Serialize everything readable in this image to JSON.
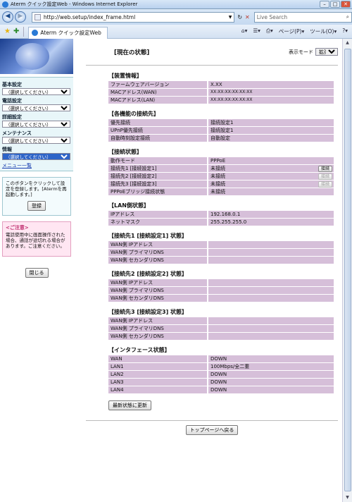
{
  "window": {
    "title": "Aterm クイック設定Web - Windows Internet Explorer",
    "url": "http://web.setup/index_frame.html",
    "search_placeholder": "Live Search",
    "tab_label": "Aterm クイック設定Web",
    "tools": {
      "page": "ページ(P)",
      "tool": "ツール(O)"
    }
  },
  "sidebar": {
    "sections": [
      {
        "label": "基本設定",
        "select": "（選択してください）"
      },
      {
        "label": "電話設定",
        "select": "（選択してください）"
      },
      {
        "label": "詳細設定",
        "select": "（選択してください）"
      },
      {
        "label": "メンテナンス",
        "select": "（選択してください）"
      },
      {
        "label": "情報",
        "select": "（選択してください）"
      }
    ],
    "menu_list": "メニュー一覧",
    "register_text": "このボタンをクリックして設定を登録します。[Atermを再起動します。]",
    "register_button": "登録",
    "caution_title": "<ご注意>",
    "caution_text": "電話使用中に画面操作された場合、通話が途切れる場合があります。ご注意ください。",
    "close_button": "閉じる"
  },
  "main": {
    "title": "[現在の状態]",
    "mode_label": "表示モード",
    "mode_value": "拡張",
    "refresh_button": "最新状態に更新",
    "top_button": "トップページへ戻る",
    "sections": [
      {
        "title": "【装置情報】",
        "rows": [
          {
            "k": "ファームウェアバージョン",
            "v": "X.XX"
          },
          {
            "k": "MACアドレス(WAN)",
            "v": "XX:XX:XX:XX:XX:XX",
            "small": true
          },
          {
            "k": "MACアドレス(LAN)",
            "v": "XX:XX:XX:XX:XX:XX",
            "small": true
          }
        ]
      },
      {
        "title": "【各機能の接続先】",
        "rows": [
          {
            "k": "優先接続",
            "v": "接続設定1"
          },
          {
            "k": "UPnP優先接続",
            "v": "接続設定1"
          },
          {
            "k": "自動時刻設定接続",
            "v": "自動設定"
          }
        ]
      },
      {
        "title": "【接続状態】",
        "rows": [
          {
            "k": "動作モード",
            "v": "PPPoE"
          },
          {
            "k": "接続先1 [接続設定1]",
            "v": "未接続",
            "btn": "接続",
            "btn_disabled": false
          },
          {
            "k": "接続先2 [接続設定2]",
            "v": "未接続",
            "btn": "接続",
            "btn_disabled": true
          },
          {
            "k": "接続先3 [接続設定3]",
            "v": "未接続",
            "btn": "接続",
            "btn_disabled": true
          },
          {
            "k": "PPPoEブリッジ接続状態",
            "v": "未接続"
          }
        ]
      },
      {
        "title": "【LAN側状態】",
        "rows": [
          {
            "k": "IPアドレス",
            "v": "192.168.0.1"
          },
          {
            "k": "ネットマスク",
            "v": "255.255.255.0"
          }
        ]
      },
      {
        "title": "【接続先1 [接続設定1] 状態】",
        "rows": [
          {
            "k": "WAN側 IPアドレス",
            "v": ""
          },
          {
            "k": "WAN側 プライマリDNS",
            "v": ""
          },
          {
            "k": "WAN側 セカンダリDNS",
            "v": ""
          }
        ]
      },
      {
        "title": "【接続先2 [接続設定2] 状態】",
        "rows": [
          {
            "k": "WAN側 IPアドレス",
            "v": ""
          },
          {
            "k": "WAN側 プライマリDNS",
            "v": ""
          },
          {
            "k": "WAN側 セカンダリDNS",
            "v": ""
          }
        ]
      },
      {
        "title": "【接続先3 [接続設定3] 状態】",
        "rows": [
          {
            "k": "WAN側 IPアドレス",
            "v": ""
          },
          {
            "k": "WAN側 プライマリDNS",
            "v": ""
          },
          {
            "k": "WAN側 セカンダリDNS",
            "v": ""
          }
        ]
      },
      {
        "title": "【インタフェース状態】",
        "rows": [
          {
            "k": "WAN",
            "v": "DOWN"
          },
          {
            "k": "LAN1",
            "v": "100Mbps/全二重"
          },
          {
            "k": "LAN2",
            "v": "DOWN"
          },
          {
            "k": "LAN3",
            "v": "DOWN"
          },
          {
            "k": "LAN4",
            "v": "DOWN"
          }
        ]
      }
    ]
  }
}
